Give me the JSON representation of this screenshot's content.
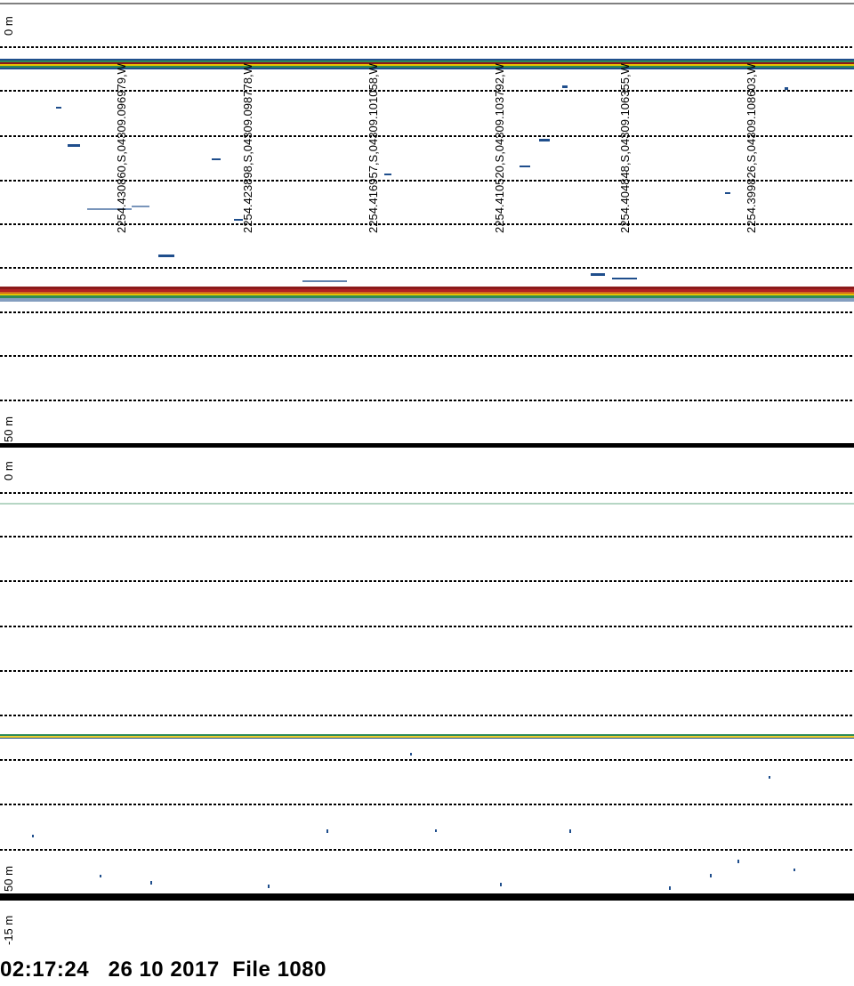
{
  "footer": {
    "time": "02:17:24",
    "date": "26 10 2017",
    "file": "File 1080"
  },
  "top_panel": {
    "depth_top_label": "0  m",
    "depth_bottom_label": "50  m",
    "positions": [
      "2254.430860,S,04309.096979,W",
      "2254.423898,S,04309.098778,W",
      "2254.416957,S,04309.101058,W",
      "2254.410520,S,04309.103792,W",
      "2254.404848,S,04309.106355,W",
      "2254.399826,S,04309.108603,W"
    ]
  },
  "bottom_panel": {
    "depth_top_label": "0  m",
    "depth_bottom_label": "50  m",
    "offset_label": "-15  m"
  },
  "colors": {
    "grid": "#000000",
    "echo_red": "#8b1a1a",
    "echo_orange": "#d2691e",
    "echo_yellow": "#e6c200",
    "echo_green": "#2e8b57",
    "echo_blue": "#1f4e8c"
  }
}
